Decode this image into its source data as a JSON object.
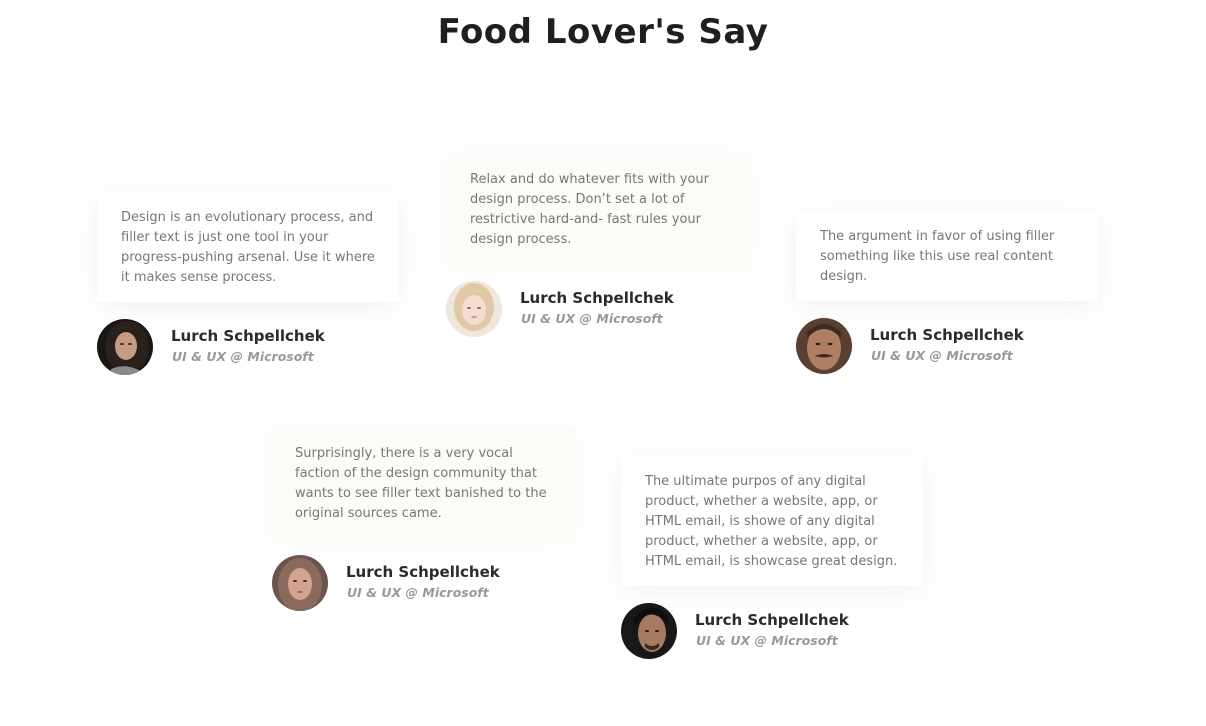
{
  "section": {
    "title": "Food Lover's Say"
  },
  "testimonials": [
    {
      "quote": "Design is an evolutionary process, and filler text is just one tool in your progress-pushing arsenal. Use it where it makes sense process.",
      "name": "Lurch Schpellchek",
      "role": "UI & UX @ Microsoft",
      "avatar_icon": "woman-dark-hair-portrait"
    },
    {
      "quote": "Relax and do whatever fits with your design process. Don’t set a lot of restrictive hard-and- fast rules your design process.",
      "name": "Lurch Schpellchek",
      "role": "UI & UX @ Microsoft",
      "avatar_icon": "woman-blonde-portrait"
    },
    {
      "quote": "The argument in favor of using filler something like this use real content design.",
      "name": "Lurch Schpellchek",
      "role": "UI & UX @ Microsoft",
      "avatar_icon": "man-mustache-portrait"
    },
    {
      "quote": "Surprisingly, there is a very vocal faction of the design community that wants to see filler text banished to the original sources came.",
      "name": "Lurch Schpellchek",
      "role": "UI & UX @ Microsoft",
      "avatar_icon": "woman-long-hair-portrait"
    },
    {
      "quote": "The ultimate purpos of any digital product, whether a website, app, or HTML email, is showe of any digital product, whether a website, app, or HTML email, is showcase great design.",
      "name": "Lurch Schpellchek",
      "role": "UI & UX @ Microsoft",
      "avatar_icon": "man-dark-portrait"
    }
  ]
}
